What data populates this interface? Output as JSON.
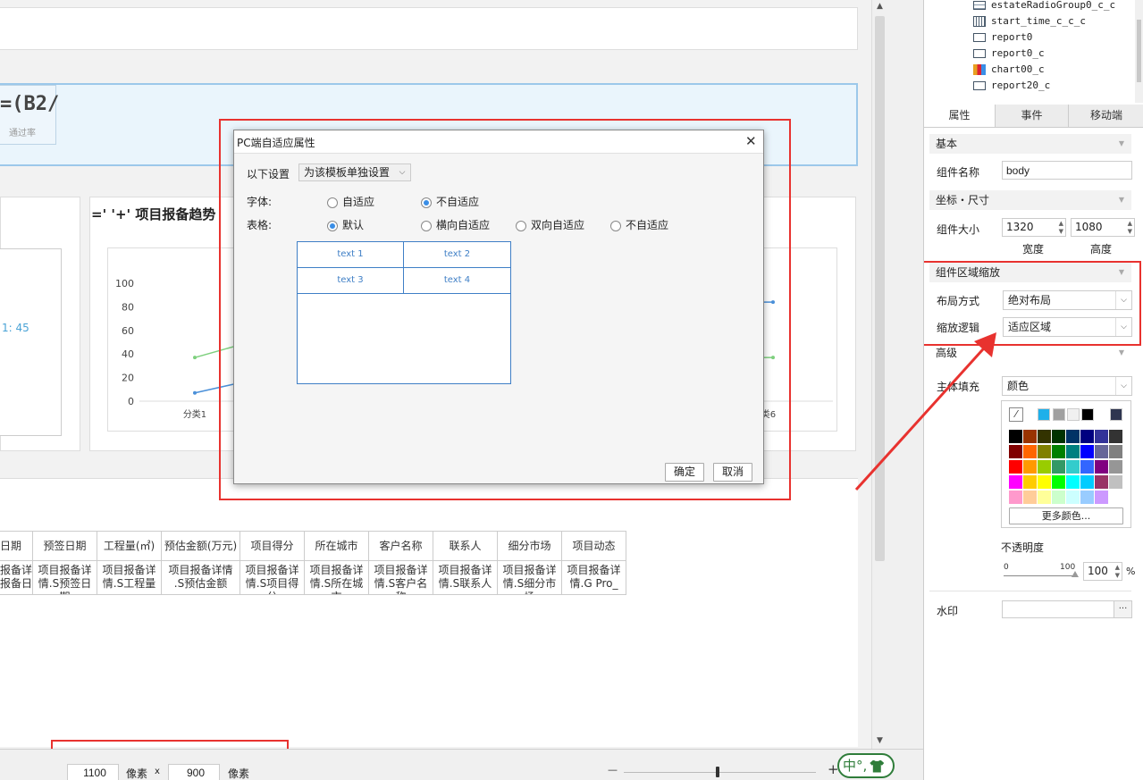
{
  "canvas": {
    "formula_text": "=(B2/",
    "formula_caption": "通过率",
    "value_label": "1: 45",
    "chart_title": "=' '+'  项目报备趋势"
  },
  "chart_data": {
    "type": "line",
    "categories": [
      "分类1",
      "分类6"
    ],
    "yticks": [
      "100",
      "80",
      "60",
      "40",
      "20",
      "0"
    ],
    "ylim": [
      0,
      100
    ],
    "series": [
      {
        "color": "#7ed07e",
        "points": [
          [
            0,
            37
          ]
        ]
      },
      {
        "color": "#4a90d9",
        "points": [
          [
            0,
            7
          ]
        ]
      }
    ],
    "grid": false
  },
  "table": {
    "headers": [
      "日期",
      "预签日期",
      "工程量(㎡)",
      "预估金额(万元)",
      "项目得分",
      "所在城市",
      "客户名称",
      "联系人",
      "细分市场",
      "项目动态"
    ],
    "cells": [
      "报备详\n报备日",
      "项目报备详\n情.S预签日\n期",
      "项目报备详\n情.S工程量",
      "项目报备详情\n.S预估金额",
      "项目报备详\n情.S项目得\n分",
      "项目报备详\n情.S所在城\n市",
      "项目报备详\n情.S客户名\n称",
      "项目报备详\n情.S联系人",
      "项目报备详\n情.S细分市\n场",
      "项目报备详\n情.G Pro_\n..."
    ]
  },
  "dialog": {
    "title": "PC端自适应属性",
    "close": "✕",
    "setting_label": "以下设置",
    "setting_value": "为该模板单独设置",
    "font_label": "字体:",
    "font_options": [
      "自适应",
      "不自适应"
    ],
    "font_selected": 1,
    "table_label": "表格:",
    "table_options": [
      "默认",
      "横向自适应",
      "双向自适应",
      "不自适应"
    ],
    "table_selected": 0,
    "preview_cells": [
      "text 1",
      "text 2",
      "text 3",
      "text 4"
    ],
    "ok": "确定",
    "cancel": "取消"
  },
  "bottom": {
    "width_value": "1100",
    "unit1": "像素",
    "times": "x",
    "height_value": "900",
    "unit2": "像素",
    "zoom_minus": "—",
    "zoom_plus": "+",
    "ime": "中°,"
  },
  "tree": {
    "items": [
      {
        "label": "estateRadioGroup0_c_c",
        "icon": "radio-group-icon"
      },
      {
        "label": "start_time_c_c_c",
        "icon": "calendar-icon"
      },
      {
        "label": "report0",
        "icon": "report-icon"
      },
      {
        "label": "report0_c",
        "icon": "report-icon"
      },
      {
        "label": "chart00_c",
        "icon": "chart-icon"
      },
      {
        "label": "report20_c",
        "icon": "report-icon"
      }
    ]
  },
  "panel": {
    "tabs": [
      "属性",
      "事件",
      "移动端"
    ],
    "section_basic": "基本",
    "name_label": "组件名称",
    "name_value": "body",
    "section_coord": "坐标・尺寸",
    "size_label": "组件大小",
    "width": "1320",
    "height": "1080",
    "width_cap": "宽度",
    "height_cap": "高度",
    "section_zoom": "组件区域缩放",
    "layout_label": "布局方式",
    "layout_value": "绝对布局",
    "scale_label": "缩放逻辑",
    "scale_value": "适应区域",
    "section_advanced": "高级",
    "fill_label": "主体填充",
    "fill_value": "颜色",
    "more_colors": "更多颜色...",
    "opacity_label": "不透明度",
    "opacity_min": "0",
    "opacity_max": "100",
    "opacity_value": "100",
    "opacity_unit": "%",
    "watermark_label": "水印",
    "watermark_btn": "···"
  },
  "colors": {
    "recent": [
      "#1fb0ea",
      "#a0a0a0",
      "#f0f0f0",
      "#000000",
      "#ffffff",
      "#2e3550"
    ],
    "grid": [
      "#000000",
      "#993300",
      "#333300",
      "#003300",
      "#003366",
      "#000080",
      "#333399",
      "#333333",
      "#800000",
      "#ff6600",
      "#808000",
      "#008000",
      "#008080",
      "#0000ff",
      "#666699",
      "#808080",
      "#ff0000",
      "#ff9900",
      "#99cc00",
      "#339966",
      "#33cccc",
      "#3366ff",
      "#800080",
      "#969696",
      "#ff00ff",
      "#ffcc00",
      "#ffff00",
      "#00ff00",
      "#00ffff",
      "#00ccff",
      "#993366",
      "#c0c0c0",
      "#ff99cc",
      "#ffcc99",
      "#ffff99",
      "#ccffcc",
      "#ccffff",
      "#99ccff",
      "#cc99ff",
      "#ffffff"
    ],
    "accent": "#3a8ee6",
    "highlight": "#e8322f"
  }
}
